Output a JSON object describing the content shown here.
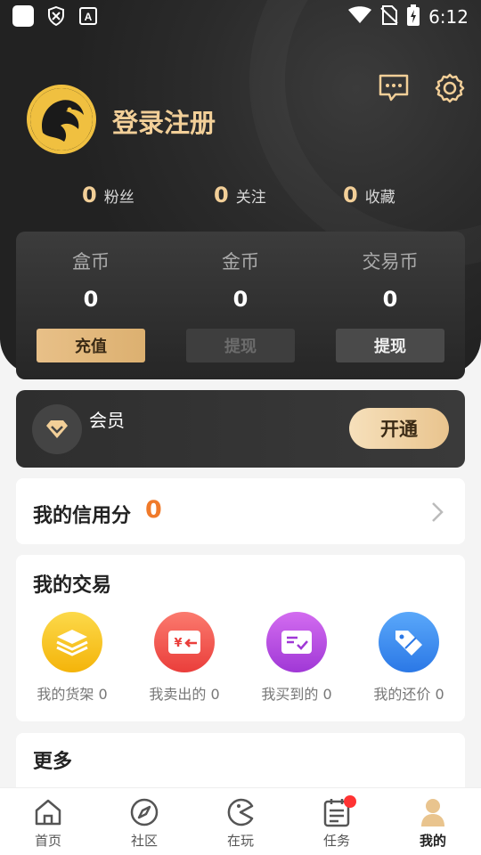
{
  "status_bar": {
    "time": "6:12"
  },
  "profile": {
    "login_label": "登录注册"
  },
  "stats": [
    {
      "num": "0",
      "label": "粉丝"
    },
    {
      "num": "0",
      "label": "关注"
    },
    {
      "num": "0",
      "label": "收藏"
    }
  ],
  "wallet": [
    {
      "title": "盒币",
      "value": "0",
      "button": "充值"
    },
    {
      "title": "金币",
      "value": "0",
      "button": "提现"
    },
    {
      "title": "交易币",
      "value": "0",
      "button": "提现"
    }
  ],
  "vip": {
    "label": "会员",
    "button": "开通"
  },
  "credit": {
    "title": "我的信用分",
    "value": "0"
  },
  "trade": {
    "title": "我的交易",
    "items": [
      {
        "label": "我的货架 0",
        "icon": "layers-icon",
        "color": "#f9c51c"
      },
      {
        "label": "我卖出的 0",
        "icon": "sell-icon",
        "color": "#f2564e"
      },
      {
        "label": "我买到的 0",
        "icon": "bought-icon",
        "color": "#b94fe0"
      },
      {
        "label": "我的还价 0",
        "icon": "tag-icon",
        "color": "#3b8ef0"
      }
    ]
  },
  "more": {
    "title": "更多"
  },
  "tabbar": [
    {
      "label": "首页",
      "icon": "home-icon"
    },
    {
      "label": "社区",
      "icon": "compass-icon"
    },
    {
      "label": "在玩",
      "icon": "pacman-icon"
    },
    {
      "label": "任务",
      "icon": "calendar-icon"
    },
    {
      "label": "我的",
      "icon": "user-icon"
    }
  ]
}
